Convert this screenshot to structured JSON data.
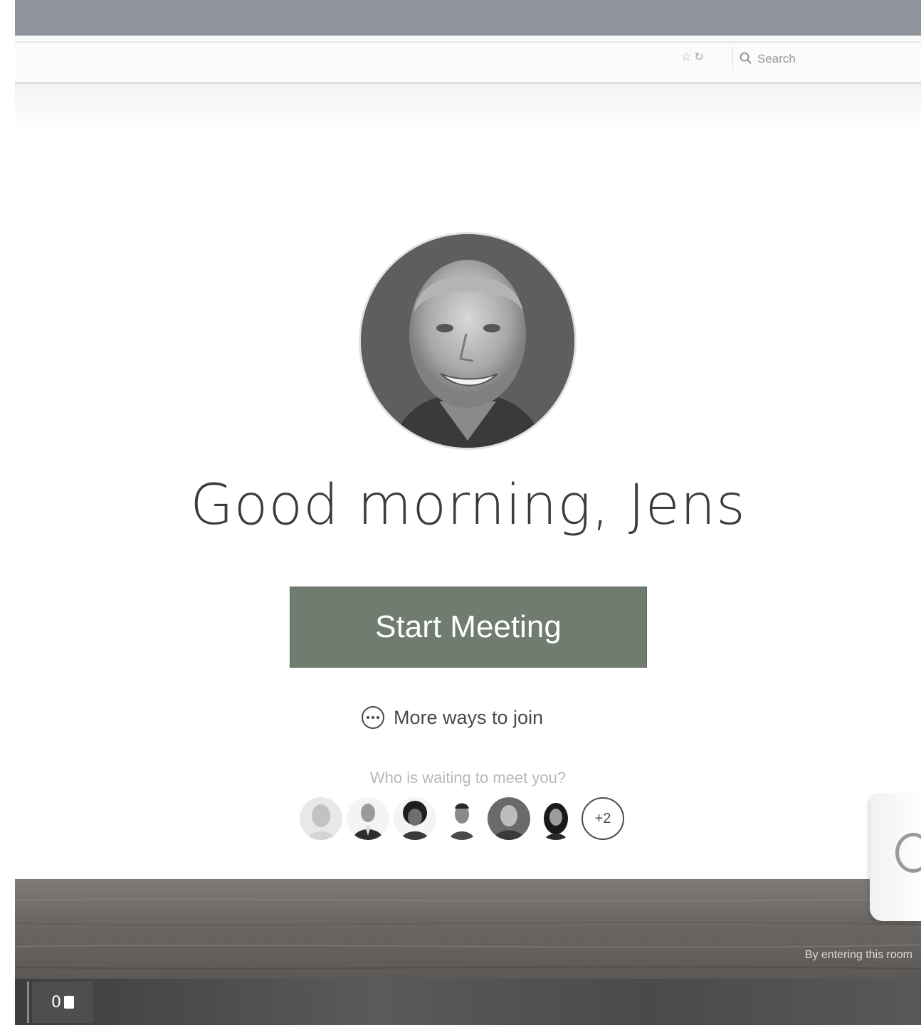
{
  "toolbar": {
    "search_placeholder": "Search",
    "icons": [
      "star-icon",
      "refresh-icon"
    ]
  },
  "main": {
    "greeting": "Good morning, Jens",
    "start_button_label": "Start Meeting",
    "more_ways_label": "More ways to join",
    "waiting_label": "Who is waiting to meet you?",
    "waiting_more_count": "+2"
  },
  "desk": {
    "caption": "By entering this room"
  },
  "taskbar": {
    "notification_count": "0"
  },
  "colors": {
    "start_button": "#6f7c6f",
    "frame": "#8e949a",
    "desk": "#6c6866"
  }
}
